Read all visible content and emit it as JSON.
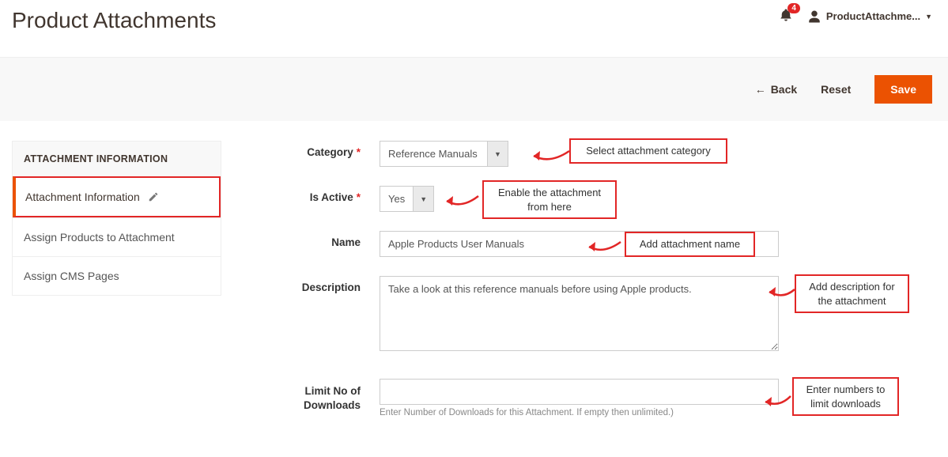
{
  "header": {
    "title": "Product Attachments",
    "notif_count": "4",
    "user_name": "ProductAttachme..."
  },
  "toolbar": {
    "back": "Back",
    "reset": "Reset",
    "save": "Save"
  },
  "sidebar": {
    "title": "ATTACHMENT INFORMATION",
    "items": [
      {
        "label": "Attachment Information"
      },
      {
        "label": "Assign Products to Attachment"
      },
      {
        "label": "Assign CMS Pages"
      }
    ]
  },
  "form": {
    "category": {
      "label": "Category",
      "value": "Reference Manuals"
    },
    "is_active": {
      "label": "Is Active",
      "value": "Yes"
    },
    "name": {
      "label": "Name",
      "value": "Apple Products User Manuals"
    },
    "description": {
      "label": "Description",
      "value": "Take a look at this reference manuals before using Apple products."
    },
    "limit": {
      "label": "Limit No of Downloads",
      "hint": "Enter Number of Downloads for this Attachment. If empty then unlimited.)"
    }
  },
  "callouts": {
    "category": "Select attachment category",
    "active": "Enable the attachment from here",
    "name": "Add attachment name",
    "desc": "Add description for the attachment",
    "limit": "Enter numbers to limit downloads"
  }
}
